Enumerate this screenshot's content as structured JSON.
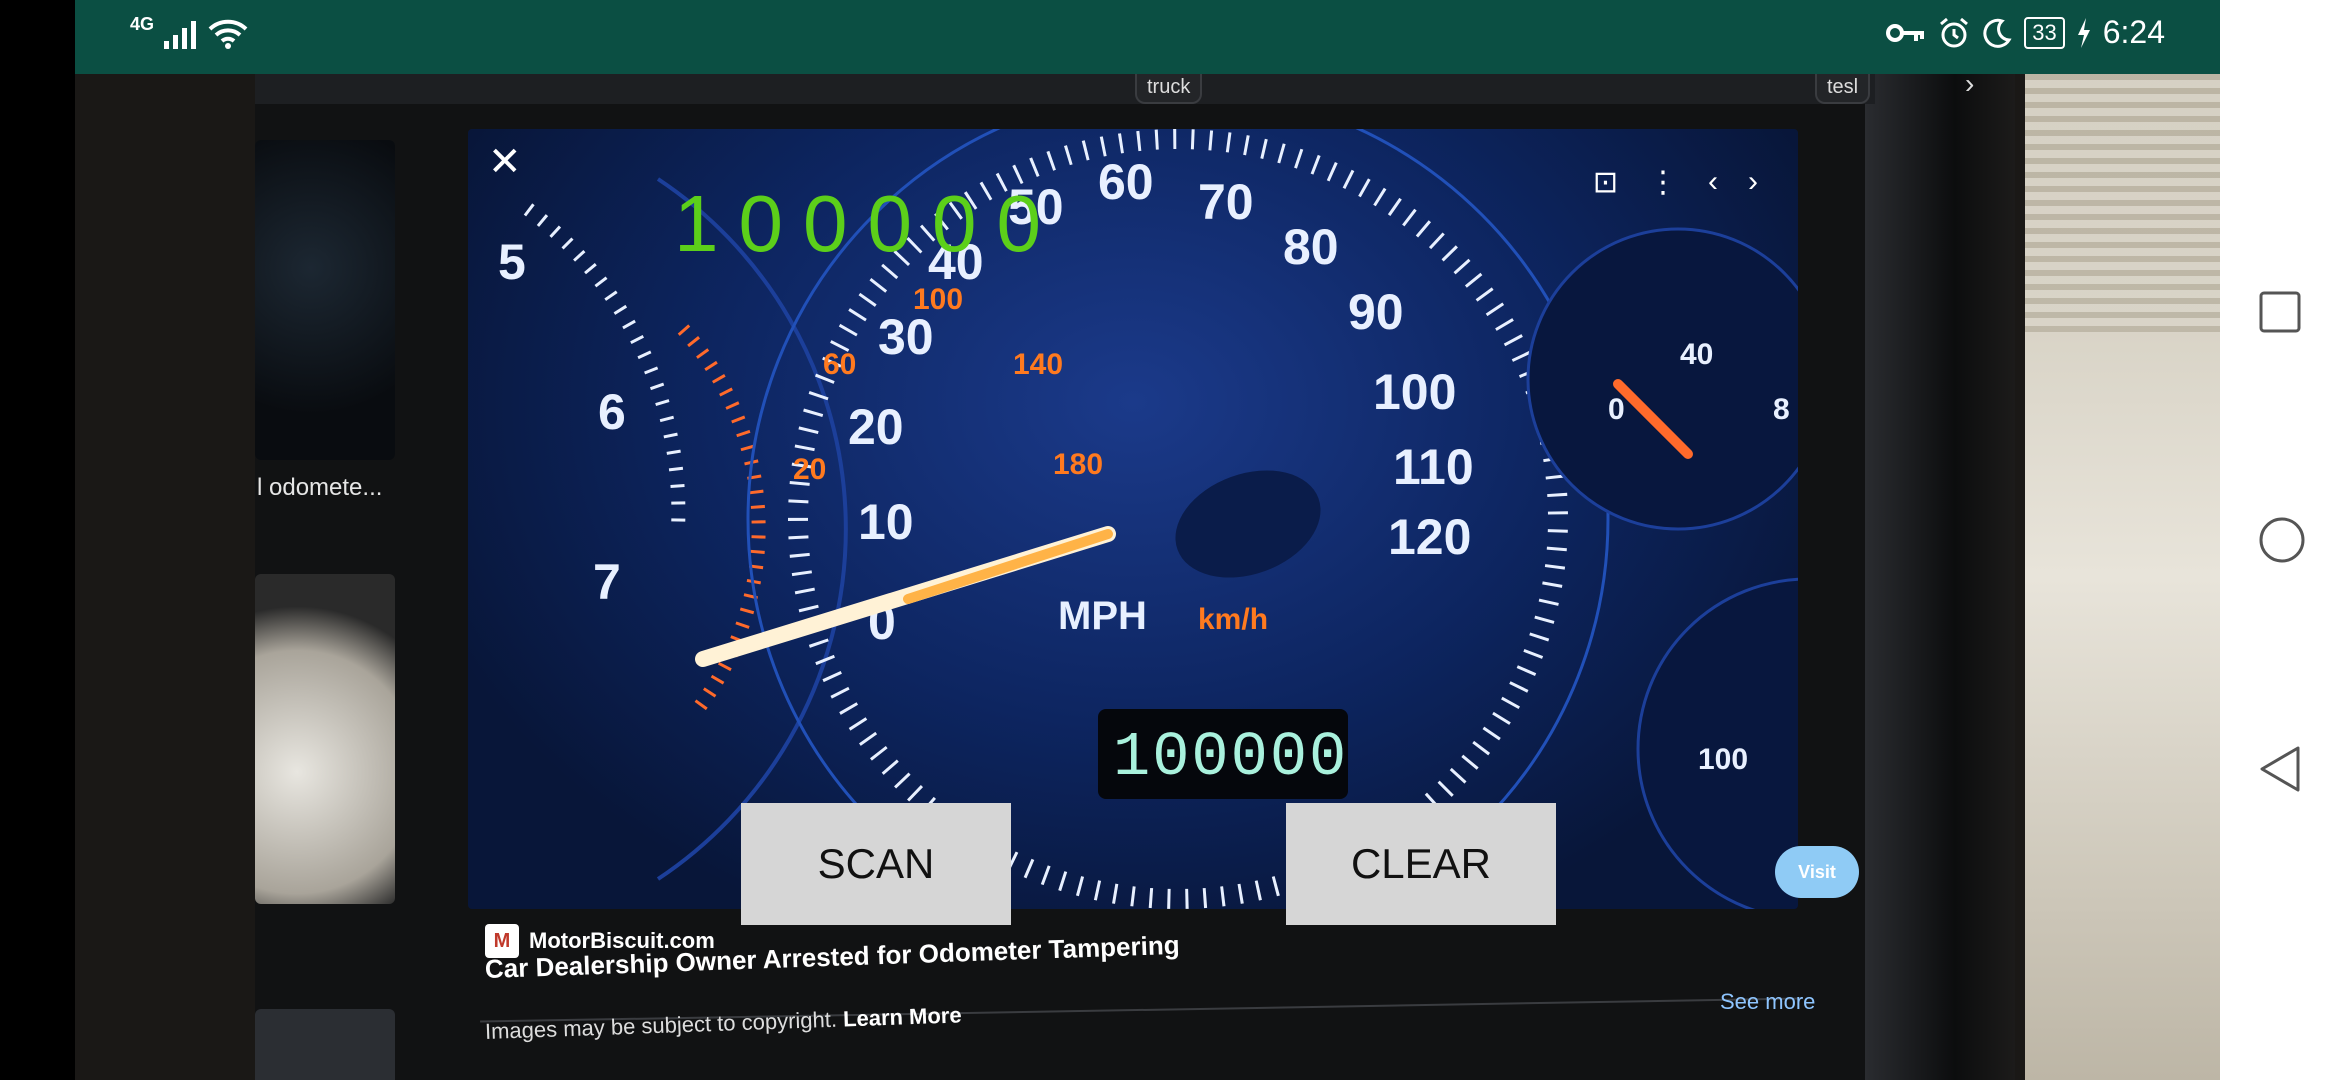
{
  "status_bar": {
    "network": "4G",
    "time": "6:24",
    "battery": "33",
    "icons": [
      "signal-icon",
      "wifi-icon",
      "vpn-key-icon",
      "alarm-icon",
      "moon-icon",
      "battery-icon",
      "charging-icon"
    ]
  },
  "camera_view": {
    "browser_strip": {
      "chips": [
        "truck",
        "tesl"
      ]
    },
    "left_thumbnail_caption": "l odomete...",
    "speedometer": {
      "mph_labels": [
        "0",
        "10",
        "20",
        "30",
        "40",
        "50",
        "60",
        "70",
        "80",
        "90",
        "100",
        "110",
        "120"
      ],
      "kmh_labels": [
        "20",
        "60",
        "100",
        "140",
        "180"
      ],
      "unit_mph": "MPH",
      "unit_kmh": "km/h",
      "odometer": "100000",
      "tach_labels": [
        "5",
        "6",
        "7"
      ],
      "oil_gauge": [
        "0",
        "40",
        "8"
      ],
      "right_gauge": "100"
    },
    "source": "MotorBiscuit.com",
    "headline": "Car Dealership Owner Arrested for Odometer Tampering",
    "copyright_text": "Images may be subject to copyright.",
    "learn_more": "Learn More",
    "visit_label": "Visit",
    "see_more": "See more"
  },
  "app": {
    "reading": "100000",
    "scan_label": "SCAN",
    "clear_label": "CLEAR"
  },
  "nav_bar": {
    "icons": [
      "recent-apps-icon",
      "home-icon",
      "back-icon"
    ]
  }
}
